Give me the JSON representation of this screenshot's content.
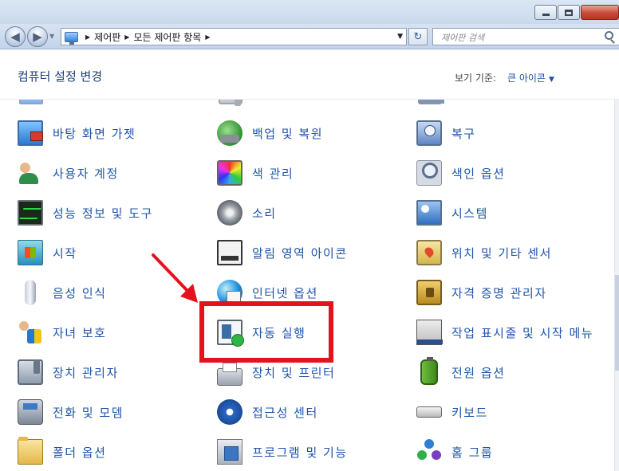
{
  "window": {
    "buttons": {
      "minimize": "minimize",
      "maximize": "maximize",
      "close": "close"
    }
  },
  "address": {
    "breadcrumbs": [
      "제어판",
      "모든 제어판 항목"
    ],
    "search_placeholder": "제어판 검색"
  },
  "header": {
    "title": "컴퓨터 설정 변경",
    "view_by_label": "보기 기준:",
    "view_by_value": "큰 아이콘"
  },
  "items": {
    "col1": [
      {
        "label": "바탕 화면 가젯",
        "icon": "desktop-gadgets-icon"
      },
      {
        "label": "사용자 계정",
        "icon": "user-accounts-icon"
      },
      {
        "label": "성능 정보 및 도구",
        "icon": "performance-icon"
      },
      {
        "label": "시작",
        "icon": "getting-started-icon"
      },
      {
        "label": "음성 인식",
        "icon": "speech-recognition-icon"
      },
      {
        "label": "자녀 보호",
        "icon": "parental-controls-icon"
      },
      {
        "label": "장치 관리자",
        "icon": "device-manager-icon"
      },
      {
        "label": "전화 및 모뎀",
        "icon": "phone-modem-icon"
      },
      {
        "label": "폴더 옵션",
        "icon": "folder-options-icon"
      }
    ],
    "col2": [
      {
        "label": "백업 및 복원",
        "icon": "backup-restore-icon"
      },
      {
        "label": "색 관리",
        "icon": "color-management-icon"
      },
      {
        "label": "소리",
        "icon": "sound-icon"
      },
      {
        "label": "알림 영역 아이콘",
        "icon": "notification-area-icon"
      },
      {
        "label": "인터넷 옵션",
        "icon": "internet-options-icon"
      },
      {
        "label": "자동 실행",
        "icon": "autoplay-icon"
      },
      {
        "label": "장치 및 프린터",
        "icon": "devices-printers-icon"
      },
      {
        "label": "접근성 센터",
        "icon": "ease-of-access-icon"
      },
      {
        "label": "프로그램 및 기능",
        "icon": "programs-features-icon"
      }
    ],
    "col3": [
      {
        "label": "복구",
        "icon": "recovery-icon"
      },
      {
        "label": "색인 옵션",
        "icon": "indexing-options-icon"
      },
      {
        "label": "시스템",
        "icon": "system-icon"
      },
      {
        "label": "위치 및 기타 센서",
        "icon": "location-sensors-icon"
      },
      {
        "label": "자격 증명 관리자",
        "icon": "credential-manager-icon"
      },
      {
        "label": "작업 표시줄 및 시작 메뉴",
        "icon": "taskbar-start-icon"
      },
      {
        "label": "전원 옵션",
        "icon": "power-options-icon"
      },
      {
        "label": "키보드",
        "icon": "keyboard-icon"
      },
      {
        "label": "홈 그룹",
        "icon": "homegroup-icon"
      }
    ]
  },
  "annotation": {
    "highlighted_item": "자동 실행",
    "color": "#e3121c"
  },
  "colors": {
    "link": "#1f53a8",
    "title": "#1e3f7a",
    "chrome": "#c9d9ec"
  }
}
